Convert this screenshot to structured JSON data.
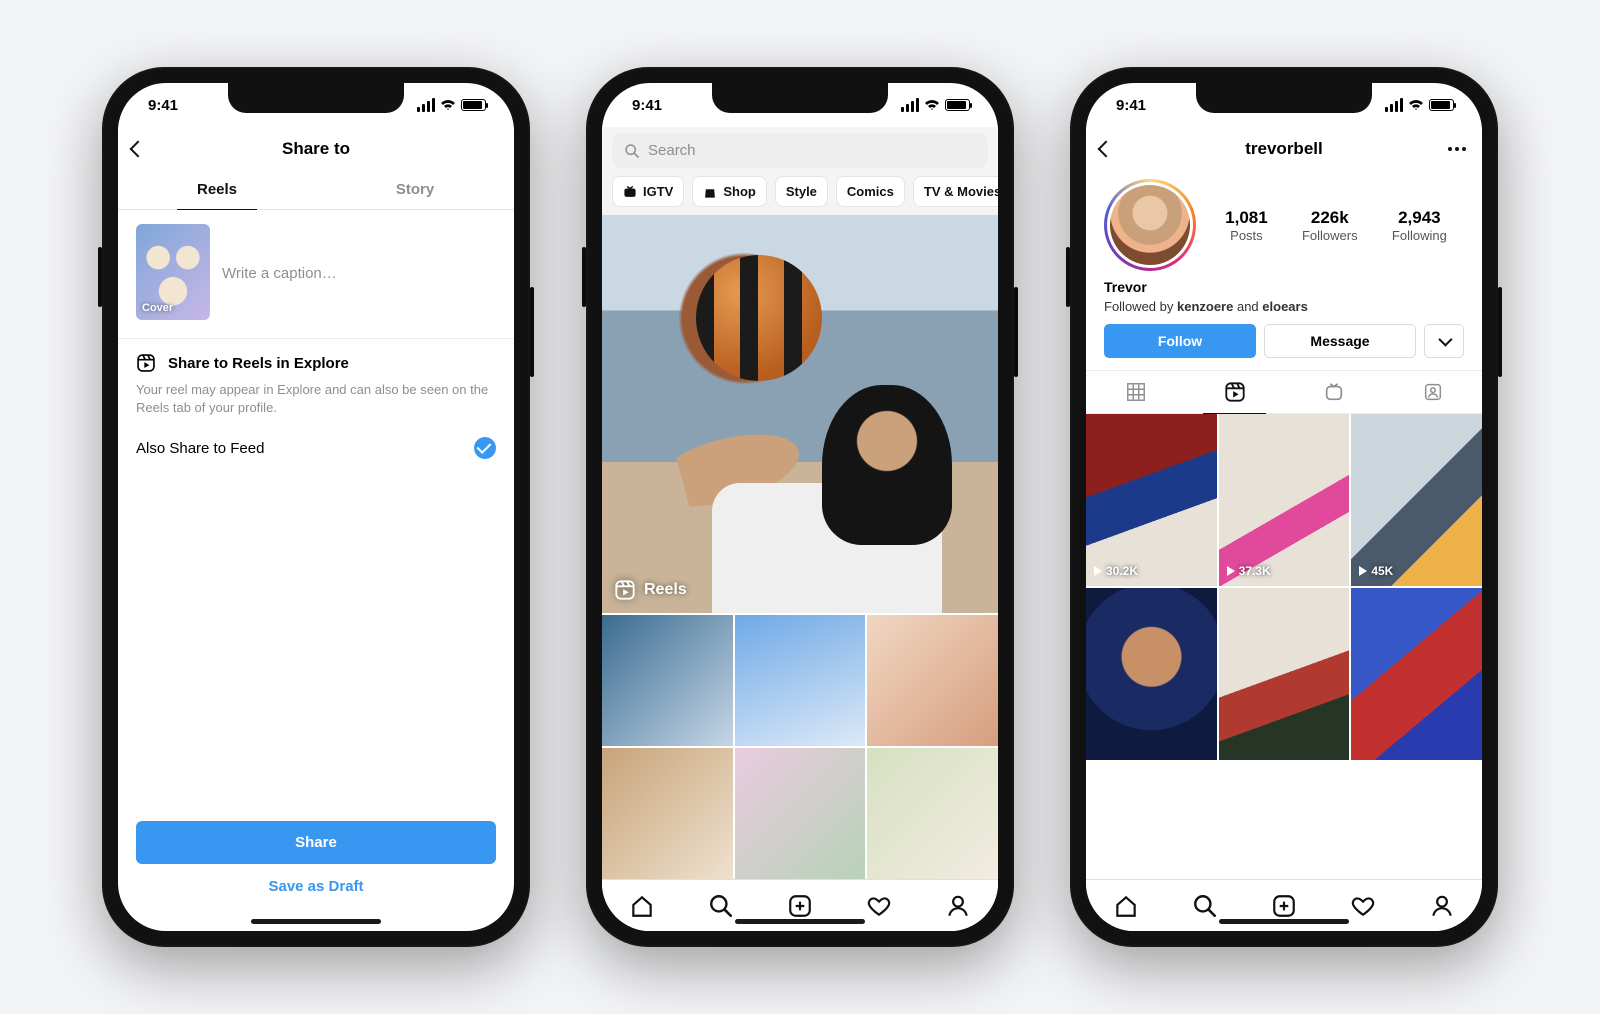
{
  "status": {
    "time": "9:41"
  },
  "phone1": {
    "title": "Share to",
    "tabs": {
      "reels": "Reels",
      "story": "Story"
    },
    "caption_placeholder": "Write a caption…",
    "cover_label": "Cover",
    "explore_heading": "Share to Reels in Explore",
    "explore_desc": "Your reel may appear in Explore and can also be seen on the Reels tab of your profile.",
    "also_feed": "Also Share to Feed",
    "share_btn": "Share",
    "draft_btn": "Save as Draft"
  },
  "phone2": {
    "search_placeholder": "Search",
    "chips": [
      {
        "label": "IGTV",
        "icon": "tv-icon"
      },
      {
        "label": "Shop",
        "icon": "bag-icon"
      },
      {
        "label": "Style",
        "icon": ""
      },
      {
        "label": "Comics",
        "icon": ""
      },
      {
        "label": "TV & Movies",
        "icon": ""
      }
    ],
    "reels_label": "Reels"
  },
  "phone3": {
    "username": "trevorbell",
    "stats": {
      "posts_num": "1,081",
      "posts_lab": "Posts",
      "followers_num": "226k",
      "followers_lab": "Followers",
      "following_num": "2,943",
      "following_lab": "Following"
    },
    "display_name": "Trevor",
    "followed_by_prefix": "Followed by ",
    "followed_by_1": "kenzoere",
    "followed_by_and": " and ",
    "followed_by_2": "eloears",
    "follow_btn": "Follow",
    "message_btn": "Message",
    "plays": {
      "c1": "30.2K",
      "c2": "37.3K",
      "c3": "45K"
    }
  }
}
